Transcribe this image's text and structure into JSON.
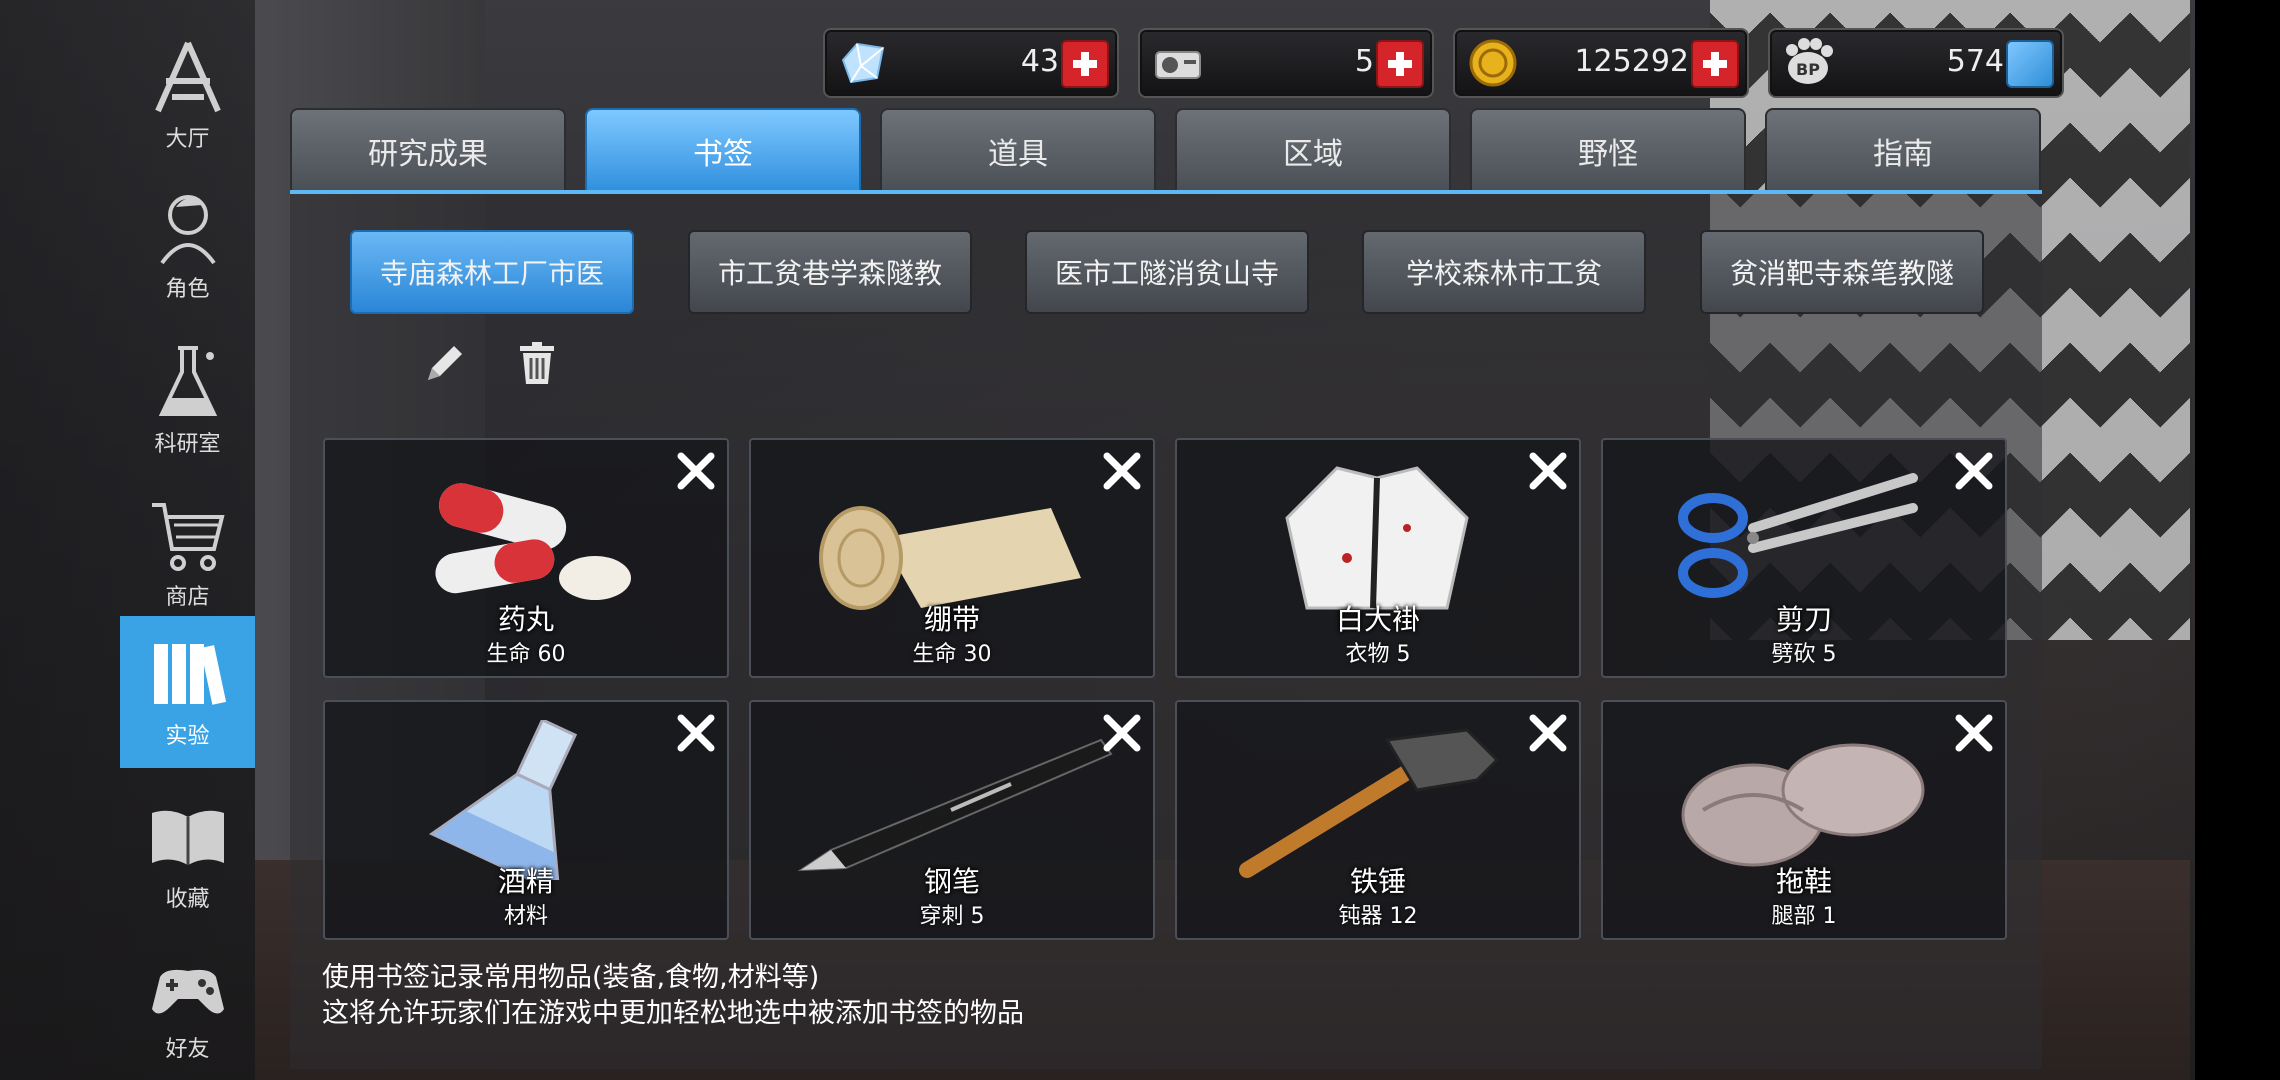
{
  "sidebar": {
    "items": [
      {
        "label": "大厅",
        "icon": "lobby-icon"
      },
      {
        "label": "角色",
        "icon": "character-icon"
      },
      {
        "label": "科研室",
        "icon": "flask-icon"
      },
      {
        "label": "商店",
        "icon": "cart-icon"
      },
      {
        "label": "实验",
        "icon": "books-icon",
        "active": true
      },
      {
        "label": "收藏",
        "icon": "open-book-icon"
      },
      {
        "label": "好友",
        "icon": "gamepad-icon"
      }
    ],
    "active_color": "#3aa3e6"
  },
  "currencies": [
    {
      "icon": "diamond-icon",
      "value": "43",
      "button": "plus"
    },
    {
      "icon": "hard-drive-icon",
      "value": "5",
      "button": "plus"
    },
    {
      "icon": "gold-coin-icon",
      "value": "125292",
      "button": "plus"
    },
    {
      "icon": "bp-paw-icon",
      "value": "574",
      "button": "cube"
    }
  ],
  "tabs": [
    {
      "label": "研究成果"
    },
    {
      "label": "书签",
      "active": true
    },
    {
      "label": "道具"
    },
    {
      "label": "区域"
    },
    {
      "label": "野怪"
    },
    {
      "label": "指南"
    }
  ],
  "bookmarks": [
    {
      "label": "寺庙森林工厂市医",
      "active": true
    },
    {
      "label": "市工贫巷学森隧教"
    },
    {
      "label": "医市工隧消贫山寺"
    },
    {
      "label": "学校森林市工贫"
    },
    {
      "label": "贫消靶寺森笔教隧"
    }
  ],
  "tools": {
    "edit_icon": "pencil-icon",
    "delete_icon": "trash-icon"
  },
  "items": [
    {
      "name": "药丸",
      "stat": "生命 60",
      "icon": "pill-icon"
    },
    {
      "name": "绷带",
      "stat": "生命 30",
      "icon": "bandage-icon"
    },
    {
      "name": "白大褂",
      "stat": "衣物 5",
      "icon": "lab-coat-icon"
    },
    {
      "name": "剪刀",
      "stat": "劈砍 5",
      "icon": "scissors-icon"
    },
    {
      "name": "酒精",
      "stat": "材料",
      "icon": "flask-icon"
    },
    {
      "name": "钢笔",
      "stat": "穿刺 5",
      "icon": "pen-icon"
    },
    {
      "name": "铁锤",
      "stat": "钝器 12",
      "icon": "hammer-icon"
    },
    {
      "name": "拖鞋",
      "stat": "腿部 1",
      "icon": "slippers-icon"
    }
  ],
  "hint": {
    "line1": "使用书签记录常用物品(装备,食物,材料等)",
    "line2": "这将允许玩家们在游戏中更加轻松地选中被添加书签的物品"
  },
  "colors": {
    "accent": "#3aa3e6",
    "close_red": "#d6252a"
  }
}
